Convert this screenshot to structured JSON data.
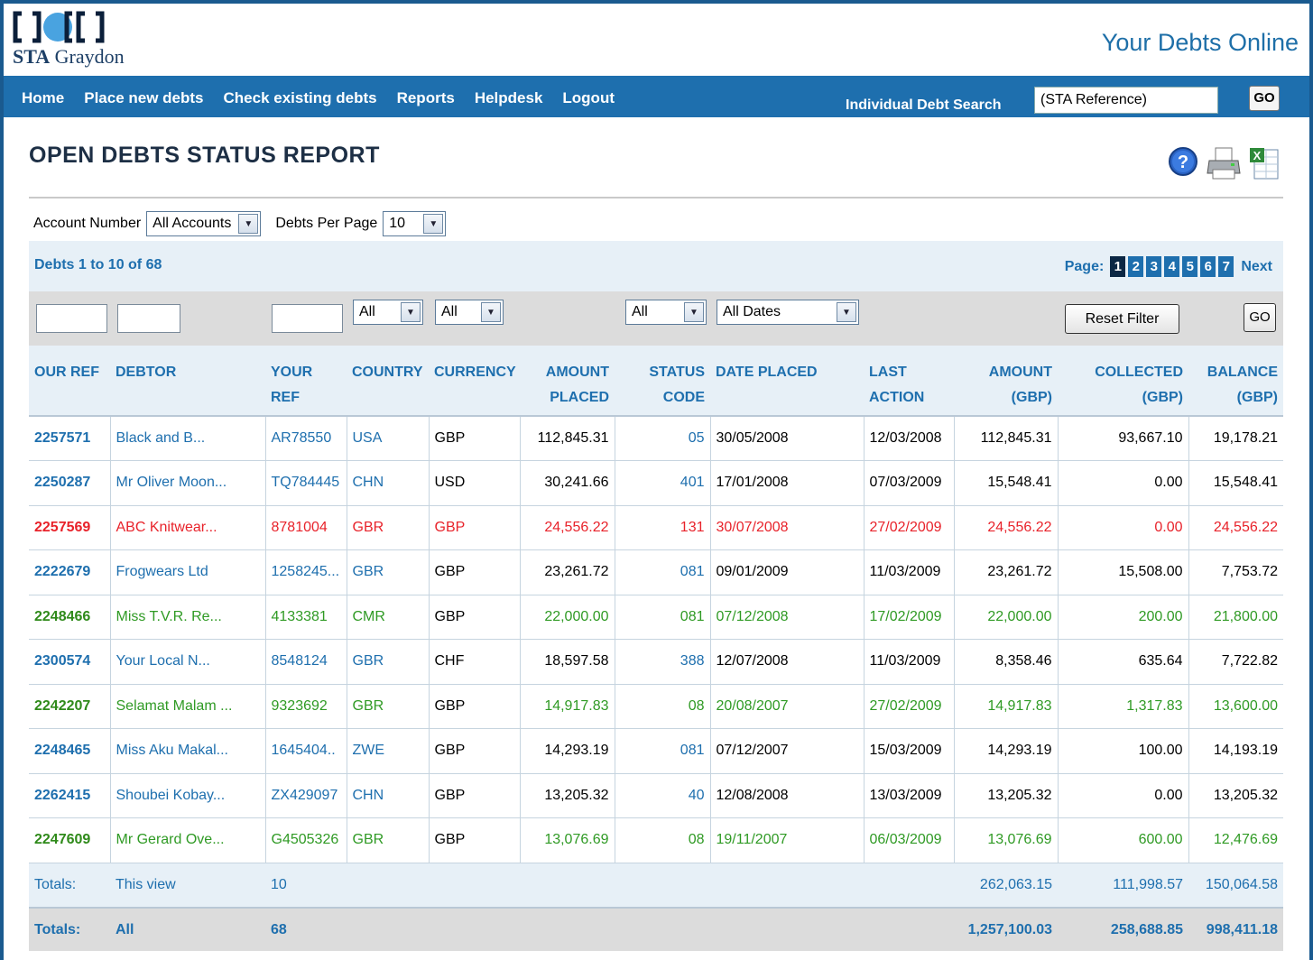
{
  "brand": {
    "company": "STA Graydon",
    "company_bold": "STA",
    "company_rest": "Graydon",
    "tagline": "Your Debts Online"
  },
  "nav": {
    "items": [
      "Home",
      "Place new debts",
      "Check existing debts",
      "Reports",
      "Helpdesk",
      "Logout"
    ],
    "search_label": "Individual Debt Search",
    "search_placeholder": "(STA Reference)",
    "go_label": "GO"
  },
  "page": {
    "title": "OPEN DEBTS STATUS REPORT",
    "icons": [
      "help-icon",
      "print-icon",
      "excel-export-icon"
    ]
  },
  "filters": {
    "account_label": "Account Number",
    "account_value": "All Accounts",
    "per_page_label": "Debts Per Page",
    "per_page_value": "10"
  },
  "results": {
    "summary": "Debts 1 to 10 of 68",
    "page_label": "Page:",
    "pages": [
      "1",
      "2",
      "3",
      "4",
      "5",
      "6",
      "7"
    ],
    "current_page": "1",
    "next_label": "Next"
  },
  "column_filters": {
    "country": "All",
    "currency": "All",
    "status": "All",
    "date": "All Dates",
    "reset_label": "Reset Filter",
    "go_label": "GO"
  },
  "table": {
    "headers": [
      [
        "OUR REF",
        ""
      ],
      [
        "DEBTOR",
        ""
      ],
      [
        "YOUR",
        "REF"
      ],
      [
        "COUNTRY",
        ""
      ],
      [
        "CURRENCY",
        ""
      ],
      [
        "AMOUNT",
        "PLACED"
      ],
      [
        "STATUS",
        "CODE"
      ],
      [
        "DATE PLACED",
        ""
      ],
      [
        "LAST",
        "ACTION"
      ],
      [
        "AMOUNT",
        "(GBP)"
      ],
      [
        "COLLECTED",
        "(GBP)"
      ],
      [
        "BALANCE",
        "(GBP)"
      ]
    ],
    "rows": [
      {
        "style": "blue",
        "cells": [
          "2257571",
          "Black and  B...",
          "AR78550",
          "USA",
          "GBP",
          "112,845.31",
          "05",
          "30/05/2008",
          "12/03/2008",
          "112,845.31",
          "93,667.10",
          "19,178.21"
        ]
      },
      {
        "style": "blue",
        "cells": [
          "2250287",
          "Mr Oliver Moon...",
          "TQ784445",
          "CHN",
          "USD",
          "30,241.66",
          "401",
          "17/01/2008",
          "07/03/2009",
          "15,548.41",
          "0.00",
          "15,548.41"
        ]
      },
      {
        "style": "red",
        "cells": [
          "2257569",
          "ABC Knitwear...",
          "8781004",
          "GBR",
          "GBP",
          "24,556.22",
          "131",
          "30/07/2008",
          "27/02/2009",
          "24,556.22",
          "0.00",
          "24,556.22"
        ]
      },
      {
        "style": "blue",
        "cells": [
          "2222679",
          "Frogwears Ltd",
          "1258245...",
          "GBR",
          "GBP",
          "23,261.72",
          "081",
          "09/01/2009",
          "11/03/2009",
          "23,261.72",
          "15,508.00",
          "7,753.72"
        ]
      },
      {
        "style": "green",
        "cells": [
          "2248466",
          "Miss T.V.R. Re...",
          "4133381",
          "CMR",
          "GBP",
          "22,000.00",
          "081",
          "07/12/2008",
          "17/02/2009",
          "22,000.00",
          "200.00",
          "21,800.00"
        ]
      },
      {
        "style": "blue",
        "cells": [
          "2300574",
          "Your Local N...",
          "8548124",
          "GBR",
          "CHF",
          "18,597.58",
          "388",
          "12/07/2008",
          "11/03/2009",
          "8,358.46",
          "635.64",
          "7,722.82"
        ]
      },
      {
        "style": "green",
        "cells": [
          "2242207",
          "Selamat Malam ...",
          "9323692",
          "GBR",
          "GBP",
          "14,917.83",
          "08",
          "20/08/2007",
          "27/02/2009",
          "14,917.83",
          "1,317.83",
          "13,600.00"
        ]
      },
      {
        "style": "blue",
        "cells": [
          "2248465",
          "Miss Aku Makal...",
          "1645404..",
          "ZWE",
          "GBP",
          "14,293.19",
          "081",
          "07/12/2007",
          "15/03/2009",
          "14,293.19",
          "100.00",
          "14,193.19"
        ]
      },
      {
        "style": "blue",
        "cells": [
          "2262415",
          "Shoubei Kobay...",
          "ZX429097",
          "CHN",
          "GBP",
          "13,205.32",
          "40",
          "12/08/2008",
          "13/03/2009",
          "13,205.32",
          "0.00",
          "13,205.32"
        ]
      },
      {
        "style": "green",
        "cells": [
          "2247609",
          "Mr Gerard Ove...",
          "G4505326",
          "GBR",
          "GBP",
          "13,076.69",
          "08",
          "19/11/2007",
          "06/03/2009",
          "13,076.69",
          "600.00",
          "12,476.69"
        ]
      }
    ],
    "totals_view": {
      "label": "Totals:",
      "scope": "This view",
      "count": "10",
      "amount": "262,063.15",
      "collected": "111,998.57",
      "balance": "150,064.58"
    },
    "totals_all": {
      "label": "Totals:",
      "scope": "All",
      "count": "68",
      "amount": "1,257,100.03",
      "collected": "258,688.85",
      "balance": "998,411.18"
    }
  },
  "colors": {
    "nav": "#1e6fae",
    "status_red": "#e8222a",
    "status_green": "#2f9a24",
    "header_band": "#e7f0f7"
  }
}
